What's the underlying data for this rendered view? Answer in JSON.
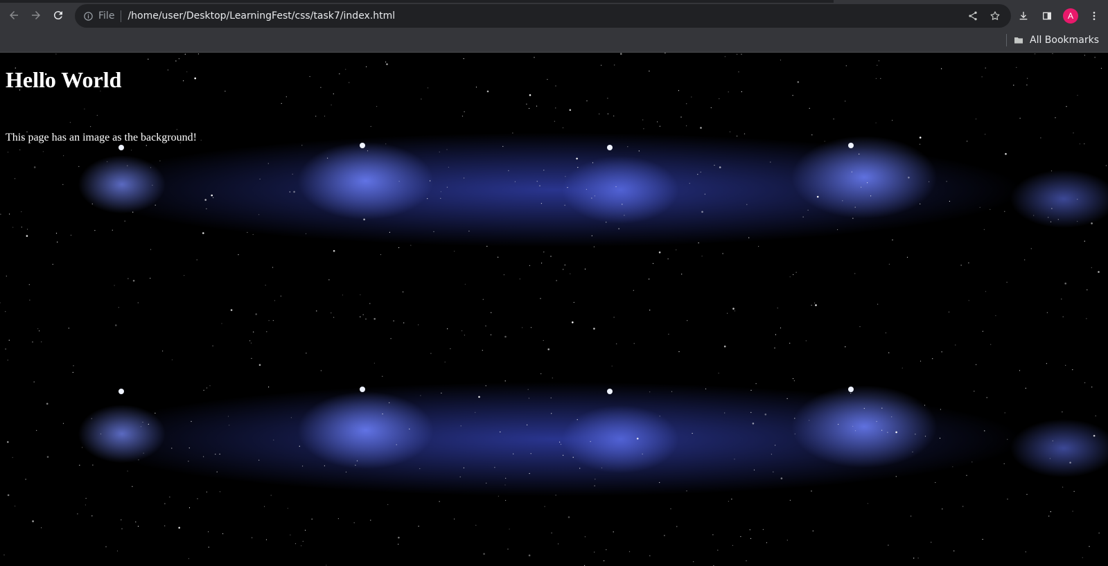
{
  "browser": {
    "address_scheme": "File",
    "url": "/home/user/Desktop/LearningFest/css/task7/index.html",
    "profile_initial": "A",
    "profile_color": "#e8196b",
    "bookmarks_label": "All Bookmarks",
    "icons": [
      "back-arrow-icon",
      "forward-arrow-icon",
      "reload-icon",
      "info-icon",
      "share-icon",
      "star-icon",
      "download-icon",
      "side-panel-icon",
      "kebab-menu-icon",
      "folder-icon"
    ]
  },
  "page": {
    "heading": "Hello World",
    "paragraph": "This page has an image as the background!",
    "text_color": "#ffffff",
    "background": "galaxy star image (repeated)"
  }
}
